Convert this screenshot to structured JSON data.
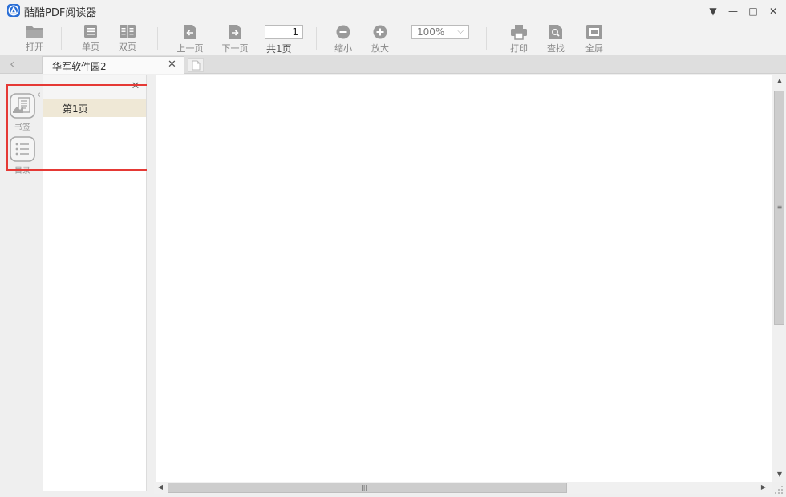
{
  "window": {
    "title": "酷酷PDF阅读器",
    "controls": [
      "▼",
      "—",
      "□",
      "✕"
    ]
  },
  "toolbar": {
    "open_label": "打开",
    "single_page_label": "单页",
    "double_page_label": "双页",
    "prev_page_label": "上一页",
    "next_page_label": "下一页",
    "page_input_value": "1",
    "page_total_label": "共1页",
    "zoom_out_label": "缩小",
    "zoom_in_label": "放大",
    "zoom_value": "100%",
    "print_label": "打印",
    "find_label": "查找",
    "fullscreen_label": "全屏"
  },
  "tabs": {
    "back_glyph": "‹",
    "items": [
      {
        "label": "华军软件园2",
        "close_glyph": "✕"
      }
    ]
  },
  "rail": {
    "bookmark_label": "书签",
    "toc_label": "目录"
  },
  "sidepanel": {
    "close_glyph": "✕",
    "collapse_glyph": "‹",
    "bookmarks": [
      {
        "label": "第1页"
      }
    ]
  },
  "colors": {
    "accent": "#2b6fd6",
    "highlight_border": "#e53935",
    "selected_bookmark_bg": "#efe8d6",
    "icon_gray": "#9a9a9a"
  }
}
